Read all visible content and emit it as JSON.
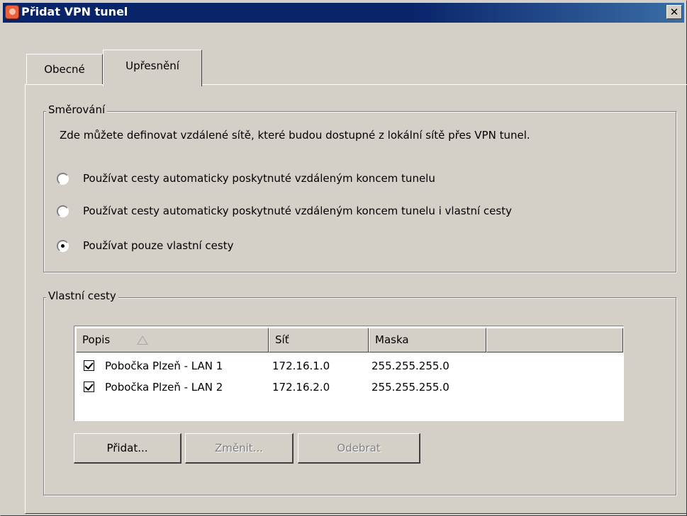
{
  "window": {
    "title": "Přidat VPN tunel",
    "close_glyph": "✕"
  },
  "tabs": [
    {
      "label": "Obecné",
      "active": false
    },
    {
      "label": "Upřesnění",
      "active": true
    }
  ],
  "routing": {
    "legend": "Směrování",
    "description": "Zde můžete definovat vzdálené sítě, které budou dostupné z lokální sítě přes VPN tunel.",
    "options": [
      {
        "label": "Používat cesty automaticky poskytnuté vzdáleným koncem tunelu",
        "selected": false
      },
      {
        "label": "Používat cesty automaticky poskytnuté vzdáleným koncem tunelu i vlastní cesty",
        "selected": false
      },
      {
        "label": "Používat pouze vlastní cesty",
        "selected": true
      }
    ]
  },
  "custom_routes": {
    "legend": "Vlastní cesty",
    "columns": [
      "Popis",
      "Síť",
      "Maska",
      ""
    ],
    "sort_icon": "sort-ascending-icon",
    "rows": [
      {
        "checked": true,
        "name": "Pobočka Plzeň - LAN 1",
        "network": "172.16.1.0",
        "mask": "255.255.255.0"
      },
      {
        "checked": true,
        "name": "Pobočka Plzeň - LAN 2",
        "network": "172.16.2.0",
        "mask": "255.255.255.0"
      }
    ],
    "buttons": {
      "add": "Přidat...",
      "edit": "Změnit...",
      "remove": "Odebrat"
    }
  },
  "colors": {
    "titlebar": "#0a246a",
    "face": "#d4d0c8",
    "disabled_text": "#808080"
  }
}
